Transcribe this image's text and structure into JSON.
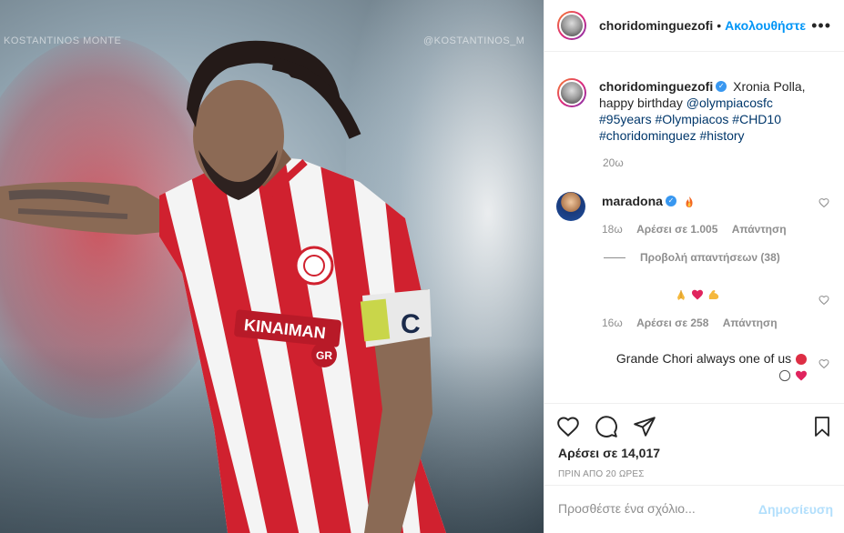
{
  "post": {
    "author": "choridominguezofi",
    "separator": "•",
    "follow_label": "Ακολουθήστε",
    "more_icon": "more-horizontal-icon",
    "watermark_left": "KOSTANTINOS MONTE",
    "watermark_right": "@KOSTANTINOS_M",
    "caption_lead": "Xronia Polla, happy birthday",
    "caption_mention": "@olympiacosfc",
    "caption_tags": [
      "#95years",
      "#Olympiacos",
      "#CHD10",
      "#choridominguez",
      "#history"
    ],
    "caption_time": "20ω",
    "jersey_sponsor": "ΚΙΝΑΙΜΑΝ",
    "jersey_sponsor_sub": "GR",
    "armband": "C"
  },
  "comments": [
    {
      "user": "maradona",
      "emoji": [
        "fire"
      ],
      "time": "18ω",
      "likes": "Αρέσει σε 1.005",
      "reply": "Απάντηση"
    },
    {
      "user": "",
      "emoji": [
        "folded-hands",
        "red-heart",
        "flexed-biceps"
      ],
      "time": "16ω",
      "likes": "Αρέσει σε 258",
      "reply": "Απάντηση"
    },
    {
      "user": "",
      "text": "Grande Chori always one of us",
      "emoji": [
        "red-circle",
        "white-circle",
        "red-heart"
      ]
    }
  ],
  "view_replies": "Προβολή απαντήσεων (38)",
  "actions": {
    "like_icon": "heart-icon",
    "comment_icon": "comment-icon",
    "share_icon": "share-icon",
    "save_icon": "bookmark-icon",
    "likes": "Αρέσει σε 14,017",
    "posted": "ΠΡΙΝ ΑΠΟ 20 ΩΡΕΣ"
  },
  "add_comment": {
    "placeholder": "Προσθέστε ένα σχόλιο...",
    "post_label": "Δημοσίευση"
  },
  "colors": {
    "accent": "#0095f6",
    "verified": "#3897f0",
    "jersey_red": "#d0212f",
    "text_muted": "#8e8e8e"
  }
}
